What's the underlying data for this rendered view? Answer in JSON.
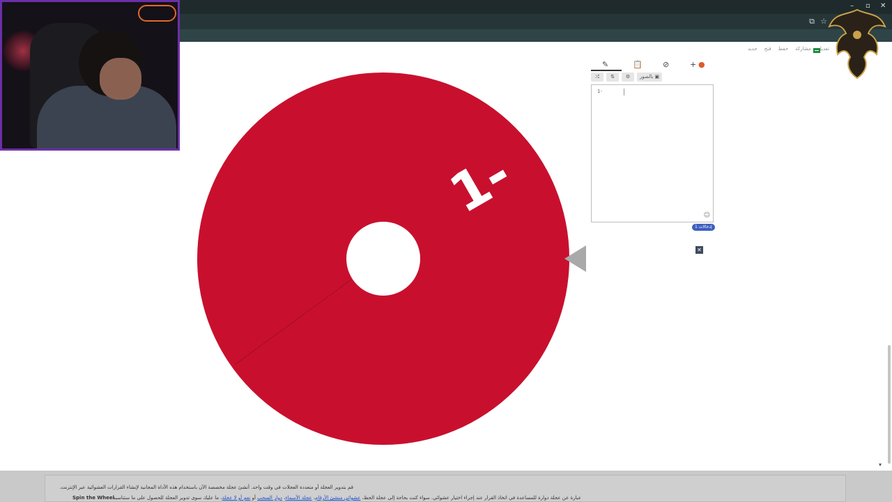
{
  "browser": {
    "minimize": "–",
    "maximize": "▫",
    "close": "✕"
  },
  "site_nav": {
    "items": [
      "تعديل",
      "مشاركة",
      "حفظ",
      "فتح",
      "جديد"
    ],
    "flag_colors": [
      "#1a8a3a",
      "#ffffff"
    ]
  },
  "wheel": {
    "segments": [
      {
        "label": "1-",
        "color": "#c8102e"
      }
    ],
    "hub_color": "#ffffff",
    "label_color": "#ffffff"
  },
  "editor": {
    "tabs": [
      {
        "name": "edit",
        "icon": "✎"
      },
      {
        "name": "clipboard",
        "icon": "📋"
      },
      {
        "name": "hide",
        "icon": "⊘"
      },
      {
        "name": "add",
        "icon": "+"
      },
      {
        "name": "color",
        "icon": "●"
      }
    ],
    "tools": [
      "⤮",
      "⇅",
      "⚙",
      "بالصور ▣"
    ],
    "entries_text": "1-",
    "entry_count_label": "إدخالات 1",
    "close_label": "✕"
  },
  "bottom": {
    "line1": "قم بتدوير العجلة أو متعددة العجلات في وقت واحد. أنشئ عجلة مخصصة الآن باستخدام هذه الأداة المجانية لإنشاء القرارات العشوائية عبر الإنترنت.",
    "line2_prefix": "عبارة عن عجلة دوارة للمساعدة في اتخاذ القرار عند إجراء اختيار عشوائي. سواء كنت بحاجة إلى عجلة الحظ،",
    "links": [
      "عشوائي منشئ الأرقام",
      "عجلة الأسماء",
      "دوار السحب",
      "نعم أو لا عجلة"
    ],
    "line2_suffix": "ما عليك سوى تدوير العجلة للحصول على ما ستناسبه",
    "brand": "Spin the Wheel"
  },
  "scroll": {
    "down_arrow": "▾"
  }
}
